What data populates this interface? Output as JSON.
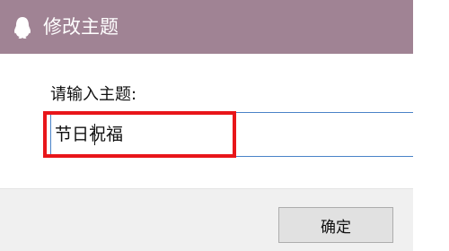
{
  "window": {
    "title": "修改主题",
    "icon": "qq-penguin-icon",
    "titlebar_color": "#a08394"
  },
  "form": {
    "prompt_label": "请输入主题:",
    "input_value": "节日祝福"
  },
  "annotation": {
    "highlight_color": "#e8161a"
  },
  "footer": {
    "ok_label": "确定"
  }
}
